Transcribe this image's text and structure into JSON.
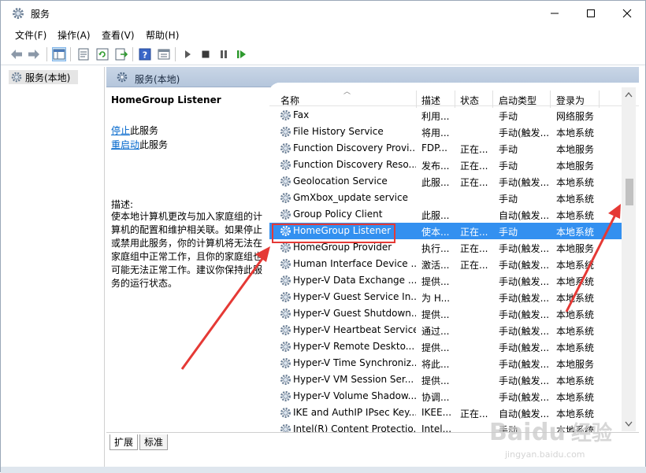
{
  "window": {
    "title": "服务",
    "colors": {
      "selection": "#3390f0",
      "header_band": "#c0d0e3",
      "link": "#0066cc",
      "annotation": "#e53935"
    }
  },
  "menu": [
    "文件(F)",
    "操作(A)",
    "查看(V)",
    "帮助(H)"
  ],
  "toolbar_icons": [
    "back-arrow-icon",
    "forward-arrow-icon",
    "console-tree-icon",
    "properties-icon",
    "refresh-icon",
    "export-icon",
    "help-icon",
    "view-icon",
    "start-icon",
    "stop-icon",
    "pause-icon",
    "restart-icon"
  ],
  "tree": {
    "item": "服务(本地)"
  },
  "content": {
    "header": "服务(本地)",
    "description": {
      "title": "HomeGroup Listener",
      "stop_link": "停止",
      "stop_suffix": "此服务",
      "restart_link": "重启动",
      "restart_suffix": "此服务",
      "label": "描述:",
      "body": "使本地计算机更改与加入家庭组的计算机的配置和维护相关联。如果停止或禁用此服务，你的计算机将无法在家庭组中正常工作，且你的家庭组也可能无法正常工作。建议你保持此服务的运行状态。"
    },
    "columns": [
      "名称",
      "描述",
      "状态",
      "启动类型",
      "登录为"
    ],
    "rows": [
      {
        "name": "Fax",
        "desc": "利用...",
        "status": "",
        "startup": "手动",
        "logon": "网络服务"
      },
      {
        "name": "File History Service",
        "desc": "将用...",
        "status": "",
        "startup": "手动(触发...",
        "logon": "本地系统"
      },
      {
        "name": "Function Discovery Provi...",
        "desc": "FDP...",
        "status": "正在...",
        "startup": "手动",
        "logon": "本地服务"
      },
      {
        "name": "Function Discovery Reso...",
        "desc": "发布...",
        "status": "正在...",
        "startup": "手动",
        "logon": "本地服务"
      },
      {
        "name": "Geolocation Service",
        "desc": "此服...",
        "status": "正在...",
        "startup": "手动(触发...",
        "logon": "本地系统"
      },
      {
        "name": "GmXbox_update service",
        "desc": "",
        "status": "",
        "startup": "手动",
        "logon": "本地系统"
      },
      {
        "name": "Group Policy Client",
        "desc": "此服...",
        "status": "",
        "startup": "自动(触发...",
        "logon": "本地系统"
      },
      {
        "name": "HomeGroup Listener",
        "desc": "使本...",
        "status": "正在...",
        "startup": "手动",
        "logon": "本地系统",
        "selected": true
      },
      {
        "name": "HomeGroup Provider",
        "desc": "执行...",
        "status": "正在...",
        "startup": "手动(触发...",
        "logon": "本地服务"
      },
      {
        "name": "Human Interface Device ...",
        "desc": "激活...",
        "status": "正在...",
        "startup": "手动(触发...",
        "logon": "本地系统"
      },
      {
        "name": "Hyper-V Data Exchange ...",
        "desc": "提供...",
        "status": "",
        "startup": "手动(触发...",
        "logon": "本地系统"
      },
      {
        "name": "Hyper-V Guest Service In...",
        "desc": "为 H...",
        "status": "",
        "startup": "手动(触发...",
        "logon": "本地系统"
      },
      {
        "name": "Hyper-V Guest Shutdown...",
        "desc": "提供...",
        "status": "",
        "startup": "手动(触发...",
        "logon": "本地系统"
      },
      {
        "name": "Hyper-V Heartbeat Service",
        "desc": "通过...",
        "status": "",
        "startup": "手动(触发...",
        "logon": "本地系统"
      },
      {
        "name": "Hyper-V Remote Deskto...",
        "desc": "提供...",
        "status": "",
        "startup": "手动(触发...",
        "logon": "本地系统"
      },
      {
        "name": "Hyper-V Time Synchroniz...",
        "desc": "将此...",
        "status": "",
        "startup": "手动(触发...",
        "logon": "本地服务"
      },
      {
        "name": "Hyper-V VM Session Ser...",
        "desc": "提供...",
        "status": "",
        "startup": "手动(触发...",
        "logon": "本地系统"
      },
      {
        "name": "Hyper-V Volume Shadow...",
        "desc": "协调...",
        "status": "",
        "startup": "手动(触发...",
        "logon": "本地系统"
      },
      {
        "name": "IKE and AuthIP IPsec Key...",
        "desc": "IKEE...",
        "status": "正在...",
        "startup": "自动(触发...",
        "logon": "本地系统"
      },
      {
        "name": "Intel(R) Content Protectio...",
        "desc": "Intel...",
        "status": "",
        "startup": "手动",
        "logon": "本地系统"
      }
    ]
  },
  "tabs": [
    "扩展",
    "标准"
  ],
  "watermark": {
    "brand": "Bai",
    "brand2": "du",
    "cn": "经验",
    "url": "jingyan.baidu.com"
  }
}
